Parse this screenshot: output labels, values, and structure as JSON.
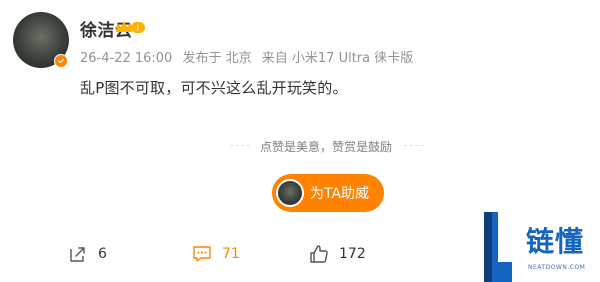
{
  "post": {
    "author": "徐洁云",
    "vip_label": "I",
    "meta": {
      "time": "26-4-22 16:00",
      "published_at": "发布于 北京",
      "source": "来自 小米17 Ultra 徕卡版"
    },
    "text": "乱P图不可取，可不兴这么乱开玩笑的。"
  },
  "reward": {
    "divider_text": "点赞是美意，赞赏是鼓励",
    "button_label": "为TA助威"
  },
  "actions": {
    "share_count": "6",
    "comment_count": "71",
    "like_count": "172"
  },
  "watermark": {
    "title": "链懂",
    "subtitle": "NEATDOWN.COM"
  },
  "colors": {
    "accent": "#ff8200",
    "text": "#333333",
    "muted": "#939393",
    "watermark_blue": "#1565c0"
  }
}
